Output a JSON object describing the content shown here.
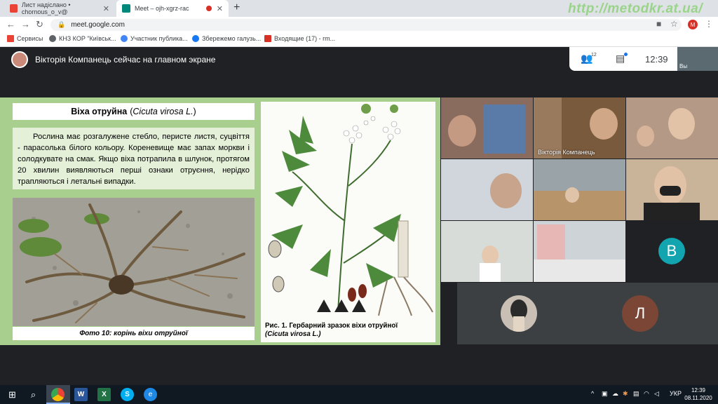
{
  "browser": {
    "tabs": [
      {
        "title": "Лист надіслано • chornous_o_v@",
        "active": false
      },
      {
        "title": "Meet – ojh-xgrz-rac",
        "active": true
      }
    ],
    "watermark": "http://metodkr.at.ua/",
    "url": "meet.google.com",
    "profile_initial": "M",
    "bookmarks": [
      {
        "label": "Сервисы",
        "color": "#ea4335"
      },
      {
        "label": "КНЗ КОР \"Київськ...",
        "color": "#5f6368"
      },
      {
        "label": "Участник публика...",
        "color": "#4285f4"
      },
      {
        "label": "Збережемо галузь...",
        "color": "#1877f2"
      },
      {
        "label": "Входящие (17) - rm...",
        "color": "#d93025"
      }
    ]
  },
  "meet": {
    "presenter_text": "Вікторія Компанець сейчас на главном экране",
    "participants_count": "12",
    "clock": "12:39",
    "self_label": "Вы",
    "tiles": [
      {
        "label": "",
        "color": "#8a6c5e"
      },
      {
        "label": "",
        "color": "#7d8f9a"
      },
      {
        "label": "Вікторія Компанець",
        "color": "#7a5a3c"
      },
      {
        "label": "",
        "color": "#b49a86"
      },
      {
        "label": "",
        "color": "#d0d6dc"
      },
      {
        "label": "",
        "color": "#6f87a0"
      },
      {
        "label": "",
        "color": "#9aa4a8"
      },
      {
        "label": "",
        "color": "#c9b49a"
      },
      {
        "label": "",
        "color": "#d7dcd8"
      },
      {
        "label": "",
        "color": "#cdd3d6"
      }
    ],
    "letter_tiles": [
      {
        "letter": "В",
        "color": "#12a4af"
      },
      {
        "letter": "Л",
        "color": "#7b4636"
      }
    ]
  },
  "slide": {
    "title_bold": "Віха отруйна",
    "title_open": "(",
    "title_latin": "Cicuta virosa L.",
    "title_close": ")",
    "description": "Рослина має розгалужене стебло, перисте листя, суцвіття - парасолька білого кольору. Кореневище має запах моркви і солодкувате на смак. Якщо віха потрапила в шлунок, протягом 20 хвилин виявляються перші ознаки отруєння, нерідко трапляються і летальні випадки.",
    "photo_caption": "Фото 10: корінь віхи отруйної",
    "herb_caption": "Рис. 1. Гербарний зразок віхи отруйної",
    "herb_caption_latin": "(Cicuta virosa L.)"
  },
  "taskbar": {
    "language": "УКР",
    "time": "12:39",
    "date": "08.11.2020"
  }
}
